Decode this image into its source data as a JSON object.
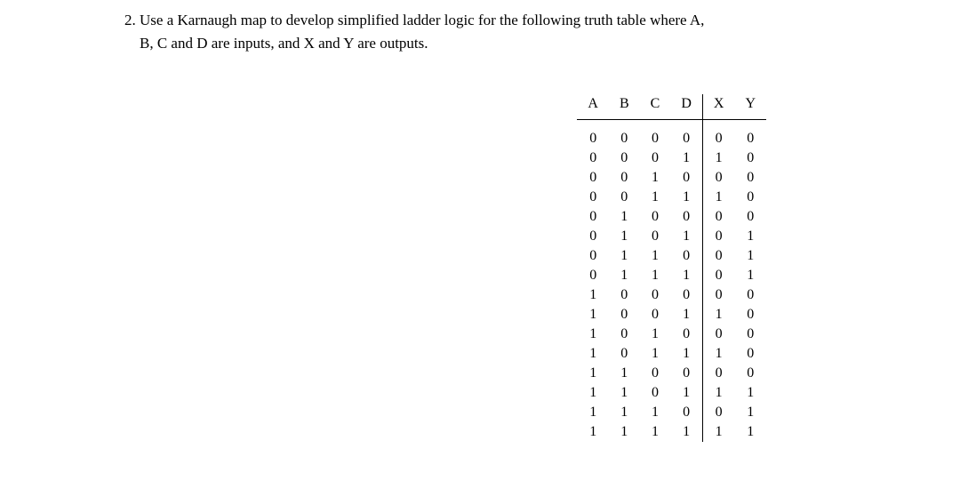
{
  "question": {
    "number": "2.",
    "text_line1": "Use a Karnaugh map to develop simplified ladder logic for the following truth table where A,",
    "text_line2": "B, C and D are inputs, and X and Y are outputs."
  },
  "table": {
    "headers": [
      "A",
      "B",
      "C",
      "D",
      "X",
      "Y"
    ],
    "rows": [
      [
        "0",
        "0",
        "0",
        "0",
        "0",
        "0"
      ],
      [
        "0",
        "0",
        "0",
        "1",
        "1",
        "0"
      ],
      [
        "0",
        "0",
        "1",
        "0",
        "0",
        "0"
      ],
      [
        "0",
        "0",
        "1",
        "1",
        "1",
        "0"
      ],
      [
        "0",
        "1",
        "0",
        "0",
        "0",
        "0"
      ],
      [
        "0",
        "1",
        "0",
        "1",
        "0",
        "1"
      ],
      [
        "0",
        "1",
        "1",
        "0",
        "0",
        "1"
      ],
      [
        "0",
        "1",
        "1",
        "1",
        "0",
        "1"
      ],
      [
        "1",
        "0",
        "0",
        "0",
        "0",
        "0"
      ],
      [
        "1",
        "0",
        "0",
        "1",
        "1",
        "0"
      ],
      [
        "1",
        "0",
        "1",
        "0",
        "0",
        "0"
      ],
      [
        "1",
        "0",
        "1",
        "1",
        "1",
        "0"
      ],
      [
        "1",
        "1",
        "0",
        "0",
        "0",
        "0"
      ],
      [
        "1",
        "1",
        "0",
        "1",
        "1",
        "1"
      ],
      [
        "1",
        "1",
        "1",
        "0",
        "0",
        "1"
      ],
      [
        "1",
        "1",
        "1",
        "1",
        "1",
        "1"
      ]
    ]
  }
}
